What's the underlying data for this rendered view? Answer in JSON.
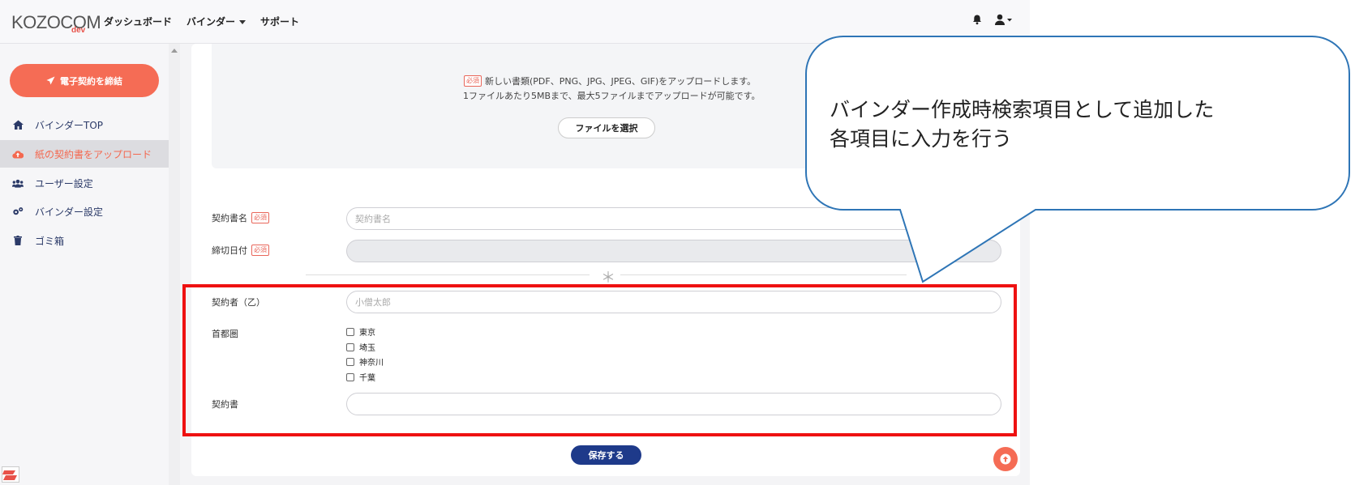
{
  "header": {
    "logo_text": "KOZOCOM",
    "logo_sub": "dev",
    "nav": [
      {
        "label": "ダッシュボード"
      },
      {
        "label": "バインダー"
      },
      {
        "label": "サポート"
      }
    ]
  },
  "sidebar": {
    "cta_label": "電子契約を締結",
    "items": [
      {
        "label": "バインダーTOP",
        "icon": "home-icon"
      },
      {
        "label": "紙の契約書をアップロード",
        "icon": "cloud-upload-icon",
        "active": true
      },
      {
        "label": "ユーザー設定",
        "icon": "users-icon"
      },
      {
        "label": "バインダー設定",
        "icon": "gears-icon"
      },
      {
        "label": "ゴミ箱",
        "icon": "trash-icon"
      }
    ]
  },
  "upload": {
    "required_badge": "必須",
    "line1": "新しい書類(PDF、PNG、JPG、JPEG、GIF)をアップロードします。",
    "line2": "1ファイルあたり5MBまで、最大5ファイルまでアップロードが可能です。",
    "button": "ファイルを選択"
  },
  "form": {
    "contract_name": {
      "label": "契約書名",
      "required_badge": "必須",
      "placeholder": "契約書名"
    },
    "deadline": {
      "label": "締切日付",
      "required_badge": "必須",
      "value": ""
    },
    "separator_symbol": "＊",
    "contractor": {
      "label": "契約者（乙）",
      "placeholder": "小僧太郎"
    },
    "capital_area": {
      "label": "首都圏",
      "options": [
        "東京",
        "埼玉",
        "神奈川",
        "千葉"
      ]
    },
    "contract": {
      "label": "契約書",
      "value": ""
    },
    "save_button": "保存する"
  },
  "callout": {
    "line1": "バインダー作成時検索項目として追加した",
    "line2": "各項目に入力を行う"
  },
  "colors": {
    "accent": "#f56c55",
    "primary_button": "#1e3a8a",
    "highlight_border": "#ee1111",
    "callout_border": "#2e75b6",
    "sidebar_text": "#2b3a68"
  }
}
